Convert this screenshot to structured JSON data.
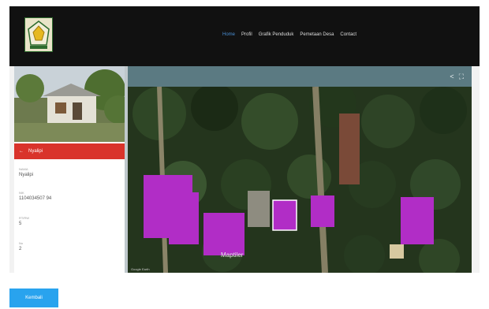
{
  "header": {
    "logo_icon": "village-crest-logo",
    "nav": [
      {
        "label": "Home",
        "active": true
      },
      {
        "label": "Profil",
        "active": false
      },
      {
        "label": "Grafik Penduduk",
        "active": false
      },
      {
        "label": "Pemetaan Desa",
        "active": false
      },
      {
        "label": "Contact",
        "active": false
      }
    ]
  },
  "sidebar": {
    "back_icon": "arrow-left-icon",
    "title": "Nyalipi",
    "fields": [
      {
        "label": "NAMA",
        "value": "Nyalipi"
      },
      {
        "label": "NIK",
        "value": "1104034507 94"
      },
      {
        "label": "RT/RW",
        "value": "5"
      },
      {
        "label": "No",
        "value": "2"
      }
    ]
  },
  "map": {
    "share_icon": "share-icon",
    "fullscreen_icon": "fullscreen-icon",
    "watermark": "Maptiler",
    "attribution": "Google Earth"
  },
  "footer": {
    "button_label": "Kembali"
  },
  "colors": {
    "header_bg": "#111111",
    "active_nav": "#4a8fd4",
    "accent_red": "#d9332b",
    "building": "#b12dc6",
    "button": "#29a3ee"
  }
}
